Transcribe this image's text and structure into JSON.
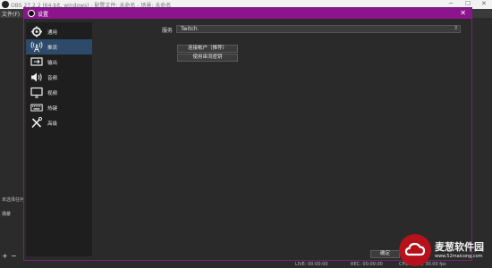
{
  "background": {
    "window_title": "OBS 27.2.2 (64-bit, windows) - 配置文件: 未命名 - 场景: 未命名",
    "menu_file": "文件(F)",
    "sources_label": "未选择任何源",
    "scenes_label": "场景",
    "add": "+",
    "remove": "−",
    "live": "LIVE: 00:00:00",
    "rec": "REC: 00:00:00",
    "cpu": "CPU: 0.5%, 30.00 fps"
  },
  "dialog": {
    "title": "设置",
    "close": "✕",
    "sidebar": [
      {
        "label": "通用",
        "icon": "gear-icon"
      },
      {
        "label": "推流",
        "icon": "broadcast-tower-icon",
        "selected": true
      },
      {
        "label": "输出",
        "icon": "output-icon"
      },
      {
        "label": "音频",
        "icon": "speaker-icon"
      },
      {
        "label": "视频",
        "icon": "monitor-icon"
      },
      {
        "label": "热键",
        "icon": "keyboard-icon"
      },
      {
        "label": "高级",
        "icon": "tools-icon"
      }
    ],
    "service": {
      "label": "服务",
      "value": "Twitch"
    },
    "connect_account": "连接帐户（推荐）",
    "use_stream_key": "使用串流密钥",
    "ok": "确定"
  },
  "watermark": {
    "text": "麦葱软件园",
    "url": "www.52maicong.com"
  },
  "colors": {
    "accent": "#8c148c",
    "selected": "#2e4a6a",
    "watermark": "#b5121b"
  }
}
